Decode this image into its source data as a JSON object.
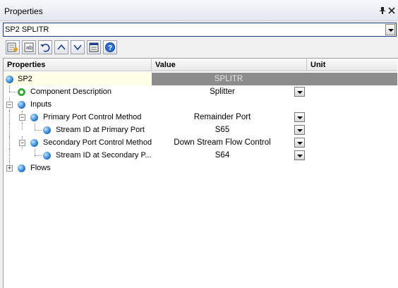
{
  "window": {
    "title": "Properties"
  },
  "selector": {
    "value": "SP2 SPLITR"
  },
  "toolbar": {
    "buttons": [
      "properties-icon",
      "categorized-icon",
      "undo-icon",
      "move-up-icon",
      "move-down-icon",
      "property-pages-icon",
      "help-icon"
    ]
  },
  "grid": {
    "columns": {
      "properties": "Properties",
      "value": "Value",
      "unit": "Unit"
    },
    "rows": [
      {
        "label": "SP2",
        "value": "SPLITR"
      },
      {
        "label": "Component Description",
        "value": "Splitter"
      },
      {
        "label": "Inputs",
        "value": ""
      },
      {
        "label": "Primary Port Control Method",
        "value": "Remainder Port"
      },
      {
        "label": "Stream ID at Primary Port",
        "value": "S65"
      },
      {
        "label": "Secondary Port Control Method",
        "value": "Down Stream Flow Control"
      },
      {
        "label": "Stream ID at Secondary P...",
        "value": "S64"
      },
      {
        "label": "Flows",
        "value": ""
      }
    ]
  },
  "colors": {
    "header_value_bg": "#8c8c8c",
    "selected_row_bg": "#fefee6",
    "combo_border": "#1c3a86"
  }
}
